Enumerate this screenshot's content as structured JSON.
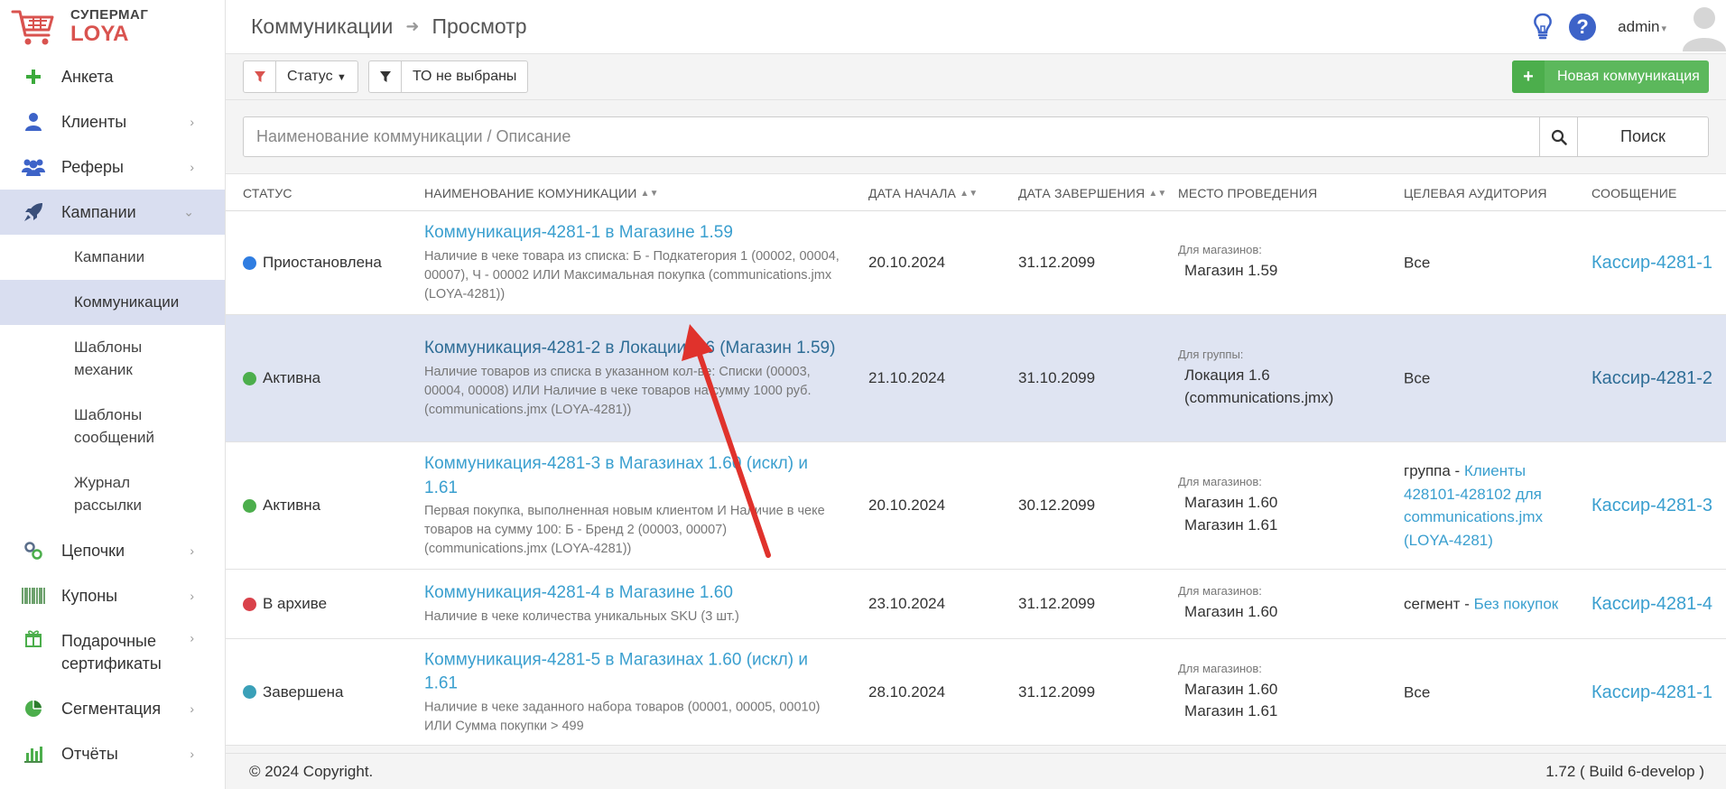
{
  "logo": {
    "top": "СУПЕРМАГ",
    "bottom": "LOYA"
  },
  "sidebar": {
    "items": [
      {
        "label": "Анкета"
      },
      {
        "label": "Клиенты"
      },
      {
        "label": "Реферы"
      },
      {
        "label": "Кампании"
      },
      {
        "label": "Цепочки"
      },
      {
        "label": "Купоны"
      },
      {
        "label": "Подарочные сертификаты"
      },
      {
        "label": "Сегментация"
      },
      {
        "label": "Отчёты"
      }
    ],
    "subitems": [
      {
        "label": "Кампании"
      },
      {
        "label": "Коммуникации"
      },
      {
        "label": "Шаблоны механик"
      },
      {
        "label": "Шаблоны сообщений"
      },
      {
        "label": "Журнал рассылки"
      }
    ]
  },
  "header": {
    "breadcrumb": [
      "Коммуникации",
      "Просмотр"
    ],
    "help": "?",
    "user": "admin"
  },
  "toolbar": {
    "status_filter": "Статус",
    "to_filter": "ТО не выбраны",
    "new_button": "Новая коммуникация"
  },
  "search": {
    "placeholder": "Наименование коммуникации / Описание",
    "button": "Поиск"
  },
  "table": {
    "headers": {
      "status": "СТАТУС",
      "name": "НАИМЕНОВАНИЕ КОМУНИКАЦИИ",
      "start": "ДАТА НАЧАЛА",
      "end": "ДАТА ЗАВЕРШЕНИЯ",
      "place": "МЕСТО ПРОВЕДЕНИЯ",
      "audience": "ЦЕЛЕВАЯ АУДИТОРИЯ",
      "message": "СООБЩЕНИЕ"
    },
    "rows": [
      {
        "status": "Приостановлена",
        "status_color": "#2f7de1",
        "name": "Коммуникация-4281-1 в Магазине 1.59",
        "description": "Наличие в чеке товара из списка: Б - Подкатегория 1 (00002, 00004, 00007), Ч - 00002 ИЛИ Максимальная покупка (communications.jmx (LOYA-4281))",
        "start": "20.10.2024",
        "end": "31.12.2099",
        "place_label": "Для магазинов:",
        "place_values": [
          "Магазин 1.59"
        ],
        "audience_prefix": "Все",
        "audience_link": "",
        "message": "Кассир-4281-1"
      },
      {
        "status": "Активна",
        "status_color": "#4cae4c",
        "name": "Коммуникация-4281-2 в Локации 1.6 (Магазин 1.59)",
        "description": "Наличие товаров из списка в указанном кол-ве: Списки (00003, 00004, 00008) ИЛИ Наличие в чеке товаров на сумму 1000 руб. (communications.jmx (LOYA-4281))",
        "start": "21.10.2024",
        "end": "31.10.2099",
        "place_label": "Для группы:",
        "place_values": [
          "Локация 1.6 (communications.jmx)"
        ],
        "audience_prefix": "Все",
        "audience_link": "",
        "message": "Кассир-4281-2"
      },
      {
        "status": "Активна",
        "status_color": "#4cae4c",
        "name": "Коммуникация-4281-3 в Магазинах 1.60 (искл) и 1.61",
        "description": "Первая покупка, выполненная новым клиентом И Наличие в чеке товаров на сумму 100: Б - Бренд 2 (00003, 00007) (communications.jmx (LOYA-4281))",
        "start": "20.10.2024",
        "end": "30.12.2099",
        "place_label": "Для магазинов:",
        "place_values": [
          "Магазин 1.60",
          "Магазин 1.61"
        ],
        "audience_prefix": "группа - ",
        "audience_link": "Клиенты 428101-428102 для communications.jmx (LOYA-4281)",
        "message": "Кассир-4281-3"
      },
      {
        "status": "В архиве",
        "status_color": "#d9414a",
        "name": "Коммуникация-4281-4 в Магазине 1.60",
        "description": "Наличие в чеке количества уникальных SKU (3 шт.)",
        "start": "23.10.2024",
        "end": "31.12.2099",
        "place_label": "Для магазинов:",
        "place_values": [
          "Магазин 1.60"
        ],
        "audience_prefix": "сегмент - ",
        "audience_link": "Без покупок",
        "message": "Кассир-4281-4"
      },
      {
        "status": "Завершена",
        "status_color": "#3aa0b8",
        "name": "Коммуникация-4281-5 в Магазинах 1.60 (искл) и 1.61",
        "description": "Наличие в чеке заданного набора товаров (00001, 00005, 00010) ИЛИ Сумма покупки > 499",
        "start": "28.10.2024",
        "end": "31.12.2099",
        "place_label": "Для магазинов:",
        "place_values": [
          "Магазин 1.60",
          "Магазин 1.61"
        ],
        "audience_prefix": "Все",
        "audience_link": "",
        "message": "Кассир-4281-1"
      }
    ]
  },
  "footer": {
    "copyright": "© 2024 Copyright.",
    "version": "1.72 ( Build 6-develop )"
  },
  "colors": {
    "accent": "#3a9fcf",
    "new_button": "#5cb85c",
    "active_menu": "#d9def0",
    "annotation_arrow": "#e0322c"
  }
}
